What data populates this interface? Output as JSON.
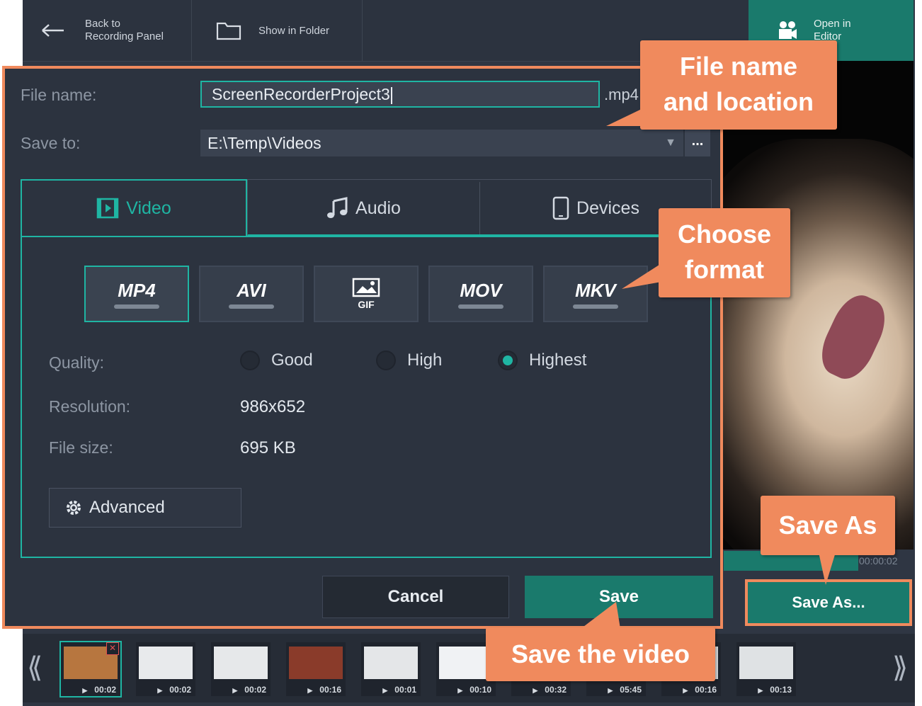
{
  "topbar": {
    "back_label_1": "Back to",
    "back_label_2": "Recording Panel",
    "folder_label": "Show in Folder",
    "editor_label_1": "Open in",
    "editor_label_2": "Editor"
  },
  "dialog": {
    "file_name_label": "File name:",
    "file_name_value": "ScreenRecorderProject3",
    "file_ext": ".mp4",
    "save_to_label": "Save to:",
    "save_to_value": "E:\\Temp\\Videos",
    "browse_label": "...",
    "tabs": [
      {
        "label": "Video",
        "icon": "film-icon",
        "selected": true
      },
      {
        "label": "Audio",
        "icon": "music-note-icon",
        "selected": false
      },
      {
        "label": "Devices",
        "icon": "phone-icon",
        "selected": false
      }
    ],
    "formats": [
      {
        "label": "MP4",
        "selected": true
      },
      {
        "label": "AVI",
        "selected": false
      },
      {
        "label": "GIF",
        "selected": false
      },
      {
        "label": "MOV",
        "selected": false
      },
      {
        "label": "MKV",
        "selected": false
      }
    ],
    "quality_label": "Quality:",
    "quality_options": [
      {
        "label": "Good",
        "selected": false
      },
      {
        "label": "High",
        "selected": false
      },
      {
        "label": "Highest",
        "selected": true
      }
    ],
    "resolution_label": "Resolution:",
    "resolution_value": "986x652",
    "file_size_label": "File size:",
    "file_size_value": "695 KB",
    "advanced_label": "Advanced",
    "cancel_label": "Cancel",
    "save_label": "Save"
  },
  "preview": {
    "time": "00:00:02",
    "save_as_label": "Save As..."
  },
  "callouts": {
    "file_name_1": "File name",
    "file_name_2": "and location",
    "format_1": "Choose",
    "format_2": "format",
    "save_as": "Save As",
    "save_video": "Save the video"
  },
  "filmstrip": {
    "times": [
      "00:02",
      "00:02",
      "00:02",
      "00:16",
      "00:01",
      "00:10",
      "00:32",
      "05:45",
      "00:16",
      "00:13"
    ]
  },
  "colors": {
    "accent_teal": "#1fb5a3",
    "button_teal": "#1a7a6c",
    "callout_orange": "#f08a5d"
  }
}
